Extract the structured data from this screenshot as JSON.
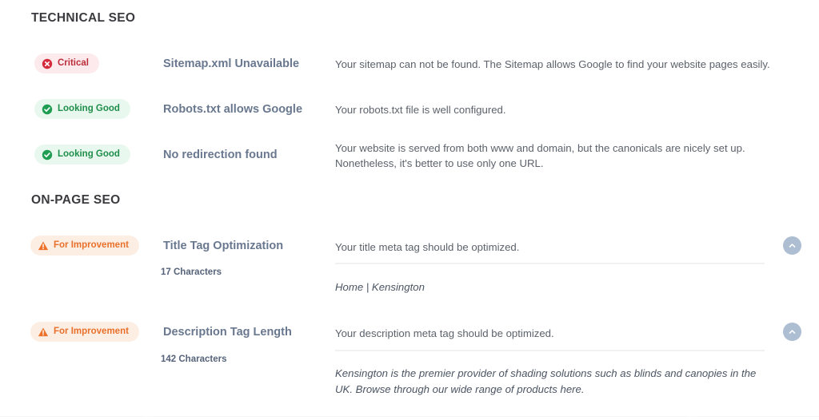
{
  "sections": [
    {
      "id": "technical-seo",
      "heading": "TECHNICAL SEO",
      "checks": [
        {
          "status_label": "Critical",
          "status_kind": "critical",
          "status_icon": "circle-x-icon",
          "title": "Sitemap.xml Unavailable",
          "description": "Your sitemap can not be found. The Sitemap allows Google to find your website pages easily."
        },
        {
          "status_label": "Looking Good",
          "status_kind": "good",
          "status_icon": "circle-check-icon",
          "title": "Robots.txt allows Google",
          "description": "Your robots.txt file is well configured."
        },
        {
          "status_label": "Looking Good",
          "status_kind": "good",
          "status_icon": "circle-check-icon",
          "title": "No redirection found",
          "description": "Your website is served from both www and domain, but the canonicals are nicely set up. Nonetheless, it's better to use only one URL."
        }
      ]
    },
    {
      "id": "on-page-seo",
      "heading": "ON-PAGE SEO",
      "checks": [
        {
          "status_label": "For Improvement",
          "status_kind": "improve",
          "status_icon": "warning-triangle-icon",
          "title": "Title Tag Optimization",
          "char_count": "17 Characters",
          "description": "Your title meta tag should be optimized.",
          "preview": "Home | Kensington",
          "collapse_icon": "chevron-up-icon"
        },
        {
          "status_label": "For Improvement",
          "status_kind": "improve",
          "status_icon": "warning-triangle-icon",
          "title": "Description Tag Length",
          "char_count": "142 Characters",
          "description": "Your description meta tag should be optimized.",
          "preview": "Kensington is the premier provider of shading solutions such as blinds and canopies in the UK. Browse through our wide range of products here.",
          "collapse_icon": "chevron-up-icon"
        }
      ]
    }
  ],
  "colors": {
    "critical_text": "#bb2d3b",
    "critical_bg": "#fdeaec",
    "critical_icon": "#d42b3c",
    "good_text": "#1e8e4a",
    "good_bg": "#e9f8ef",
    "good_icon": "#1f9d52",
    "improve_text": "#e8702a",
    "improve_bg": "#fdeee4",
    "improve_icon": "#ed7128",
    "title_link": "#69788f",
    "body_text": "#5c626b",
    "heading": "#3b3b3f",
    "collapse_button": "#adbdd2"
  }
}
